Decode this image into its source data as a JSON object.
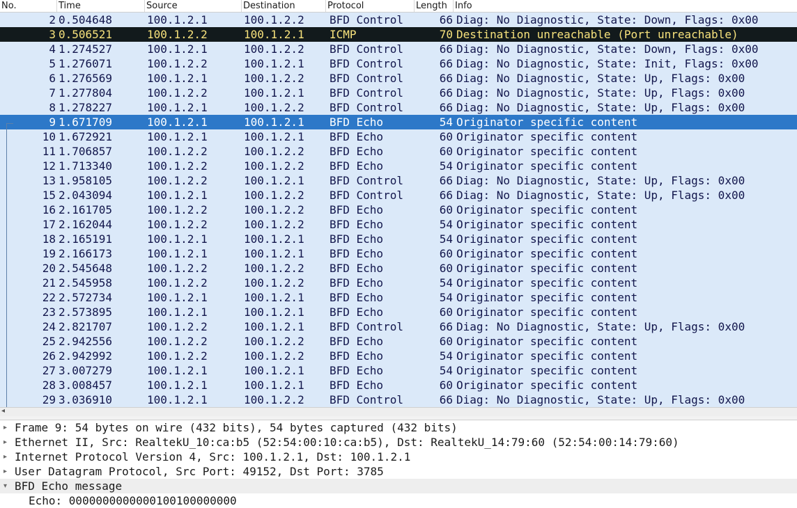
{
  "columns": {
    "no": "No.",
    "time": "Time",
    "source": "Source",
    "destination": "Destination",
    "protocol": "Protocol",
    "length": "Length",
    "info": "Info"
  },
  "packets": [
    {
      "no": "2",
      "time": "0.504648",
      "src": "100.1.2.1",
      "dst": "100.1.2.2",
      "proto": "BFD Control",
      "len": "66",
      "info": "Diag: No Diagnostic, State: Down, Flags: 0x00"
    },
    {
      "no": "3",
      "time": "0.506521",
      "src": "100.1.2.2",
      "dst": "100.1.2.1",
      "proto": "ICMP",
      "len": "70",
      "info": "Destination unreachable (Port unreachable)"
    },
    {
      "no": "4",
      "time": "1.274527",
      "src": "100.1.2.1",
      "dst": "100.1.2.2",
      "proto": "BFD Control",
      "len": "66",
      "info": "Diag: No Diagnostic, State: Down, Flags: 0x00"
    },
    {
      "no": "5",
      "time": "1.276071",
      "src": "100.1.2.2",
      "dst": "100.1.2.1",
      "proto": "BFD Control",
      "len": "66",
      "info": "Diag: No Diagnostic, State: Init, Flags: 0x00"
    },
    {
      "no": "6",
      "time": "1.276569",
      "src": "100.1.2.1",
      "dst": "100.1.2.2",
      "proto": "BFD Control",
      "len": "66",
      "info": "Diag: No Diagnostic, State: Up, Flags: 0x00"
    },
    {
      "no": "7",
      "time": "1.277804",
      "src": "100.1.2.2",
      "dst": "100.1.2.1",
      "proto": "BFD Control",
      "len": "66",
      "info": "Diag: No Diagnostic, State: Up, Flags: 0x00"
    },
    {
      "no": "8",
      "time": "1.278227",
      "src": "100.1.2.1",
      "dst": "100.1.2.2",
      "proto": "BFD Control",
      "len": "66",
      "info": "Diag: No Diagnostic, State: Up, Flags: 0x00"
    },
    {
      "no": "9",
      "time": "1.671709",
      "src": "100.1.2.1",
      "dst": "100.1.2.1",
      "proto": "BFD Echo",
      "len": "54",
      "info": "Originator specific content"
    },
    {
      "no": "10",
      "time": "1.672921",
      "src": "100.1.2.1",
      "dst": "100.1.2.1",
      "proto": "BFD Echo",
      "len": "60",
      "info": "Originator specific content"
    },
    {
      "no": "11",
      "time": "1.706857",
      "src": "100.1.2.2",
      "dst": "100.1.2.2",
      "proto": "BFD Echo",
      "len": "60",
      "info": "Originator specific content"
    },
    {
      "no": "12",
      "time": "1.713340",
      "src": "100.1.2.2",
      "dst": "100.1.2.2",
      "proto": "BFD Echo",
      "len": "54",
      "info": "Originator specific content"
    },
    {
      "no": "13",
      "time": "1.958105",
      "src": "100.1.2.2",
      "dst": "100.1.2.1",
      "proto": "BFD Control",
      "len": "66",
      "info": "Diag: No Diagnostic, State: Up, Flags: 0x00"
    },
    {
      "no": "15",
      "time": "2.043094",
      "src": "100.1.2.1",
      "dst": "100.1.2.2",
      "proto": "BFD Control",
      "len": "66",
      "info": "Diag: No Diagnostic, State: Up, Flags: 0x00"
    },
    {
      "no": "16",
      "time": "2.161705",
      "src": "100.1.2.2",
      "dst": "100.1.2.2",
      "proto": "BFD Echo",
      "len": "60",
      "info": "Originator specific content"
    },
    {
      "no": "17",
      "time": "2.162044",
      "src": "100.1.2.2",
      "dst": "100.1.2.2",
      "proto": "BFD Echo",
      "len": "54",
      "info": "Originator specific content"
    },
    {
      "no": "18",
      "time": "2.165191",
      "src": "100.1.2.1",
      "dst": "100.1.2.1",
      "proto": "BFD Echo",
      "len": "54",
      "info": "Originator specific content"
    },
    {
      "no": "19",
      "time": "2.166173",
      "src": "100.1.2.1",
      "dst": "100.1.2.1",
      "proto": "BFD Echo",
      "len": "60",
      "info": "Originator specific content"
    },
    {
      "no": "20",
      "time": "2.545648",
      "src": "100.1.2.2",
      "dst": "100.1.2.2",
      "proto": "BFD Echo",
      "len": "60",
      "info": "Originator specific content"
    },
    {
      "no": "21",
      "time": "2.545958",
      "src": "100.1.2.2",
      "dst": "100.1.2.2",
      "proto": "BFD Echo",
      "len": "54",
      "info": "Originator specific content"
    },
    {
      "no": "22",
      "time": "2.572734",
      "src": "100.1.2.1",
      "dst": "100.1.2.1",
      "proto": "BFD Echo",
      "len": "54",
      "info": "Originator specific content"
    },
    {
      "no": "23",
      "time": "2.573895",
      "src": "100.1.2.1",
      "dst": "100.1.2.1",
      "proto": "BFD Echo",
      "len": "60",
      "info": "Originator specific content"
    },
    {
      "no": "24",
      "time": "2.821707",
      "src": "100.1.2.2",
      "dst": "100.1.2.1",
      "proto": "BFD Control",
      "len": "66",
      "info": "Diag: No Diagnostic, State: Up, Flags: 0x00"
    },
    {
      "no": "25",
      "time": "2.942556",
      "src": "100.1.2.2",
      "dst": "100.1.2.2",
      "proto": "BFD Echo",
      "len": "60",
      "info": "Originator specific content"
    },
    {
      "no": "26",
      "time": "2.942992",
      "src": "100.1.2.2",
      "dst": "100.1.2.2",
      "proto": "BFD Echo",
      "len": "54",
      "info": "Originator specific content"
    },
    {
      "no": "27",
      "time": "3.007279",
      "src": "100.1.2.1",
      "dst": "100.1.2.1",
      "proto": "BFD Echo",
      "len": "54",
      "info": "Originator specific content"
    },
    {
      "no": "28",
      "time": "3.008457",
      "src": "100.1.2.1",
      "dst": "100.1.2.1",
      "proto": "BFD Echo",
      "len": "60",
      "info": "Originator specific content"
    },
    {
      "no": "29",
      "time": "3.036910",
      "src": "100.1.2.1",
      "dst": "100.1.2.2",
      "proto": "BFD Control",
      "len": "66",
      "info": "Diag: No Diagnostic, State: Up, Flags: 0x00"
    }
  ],
  "details": {
    "frame": "Frame 9: 54 bytes on wire (432 bits), 54 bytes captured (432 bits)",
    "ethernet": "Ethernet II, Src: RealtekU_10:ca:b5 (52:54:00:10:ca:b5), Dst: RealtekU_14:79:60 (52:54:00:14:79:60)",
    "ip": "Internet Protocol Version 4, Src: 100.1.2.1, Dst: 100.1.2.1",
    "udp": "User Datagram Protocol, Src Port: 49152, Dst Port: 3785",
    "bfd": "BFD Echo message",
    "echo": "Echo: 0000000000000100100000000"
  },
  "colors": {
    "row_bg": "#dbe9f9",
    "icmp_bg": "#121a1c",
    "icmp_fg": "#f7e27c",
    "selected_bg": "#2d78c8"
  }
}
